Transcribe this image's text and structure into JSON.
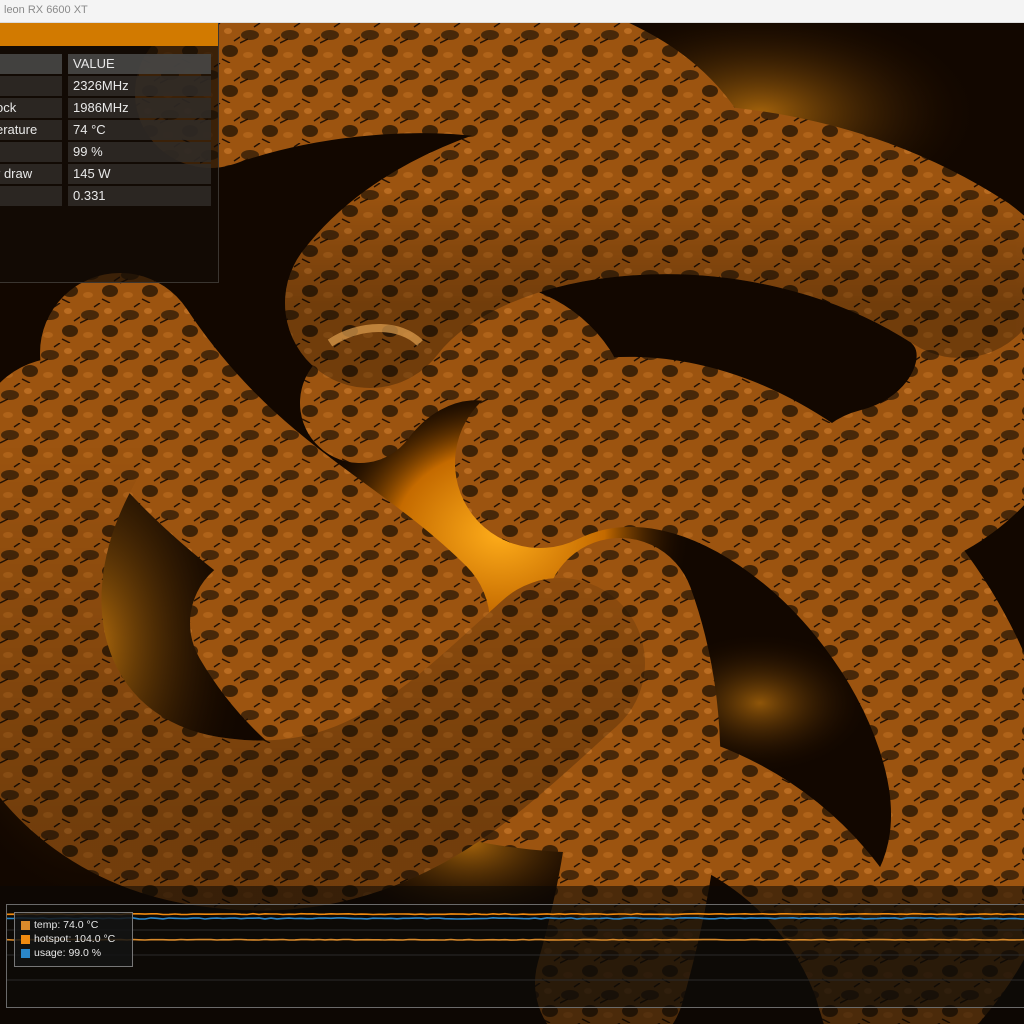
{
  "window": {
    "title": "leon RX 6600 XT"
  },
  "colors": {
    "accent": "#d27a00",
    "temp": "#d98a2b",
    "hotspot": "#f08a10",
    "usage": "#2a86c8"
  },
  "info": {
    "header": {
      "key": "",
      "value": "VALUE"
    },
    "rows": [
      {
        "key": "",
        "value": "2326MHz"
      },
      {
        "key": "ock",
        "value": "1986MHz"
      },
      {
        "key": "erature",
        "value": "74 °C"
      },
      {
        "key": "",
        "value": "99 %"
      },
      {
        "key": "r draw",
        "value": "145 W"
      },
      {
        "key": "",
        "value": "0.331"
      }
    ]
  },
  "legend": [
    {
      "label": "temp: 74.0 °C",
      "swatch": "temp"
    },
    {
      "label": "hotspot: 104.0 °C",
      "swatch": "hotspot"
    },
    {
      "label": "usage: 99.0 %",
      "swatch": "usage"
    }
  ],
  "graph": {
    "usage_level": 99.0,
    "hotspot_level": 104.0,
    "temp_level": 74.0
  }
}
